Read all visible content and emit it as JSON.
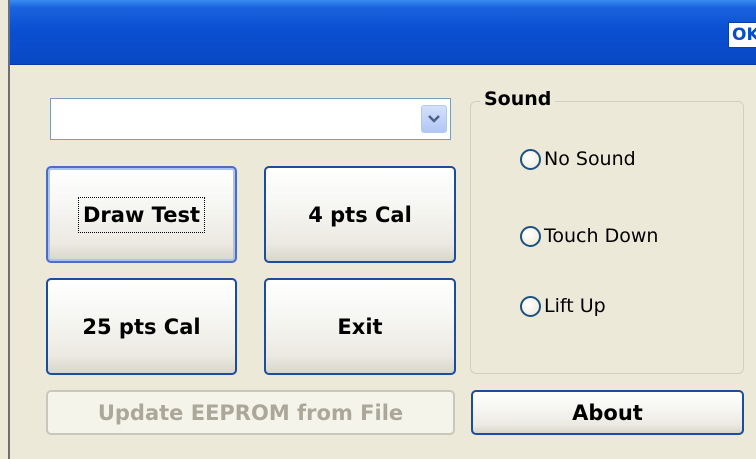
{
  "titlebar": {
    "ok_label": "OK"
  },
  "combo": {
    "value": ""
  },
  "buttons": {
    "draw_test": "Draw Test",
    "cal_4pts": "4 pts Cal",
    "cal_25pts": "25 pts Cal",
    "exit": "Exit",
    "update_eeprom": "Update EEPROM from File",
    "about": "About"
  },
  "sound_group": {
    "title": "Sound",
    "options": [
      {
        "label": "No Sound",
        "selected": false
      },
      {
        "label": "Touch Down",
        "selected": false
      },
      {
        "label": "Lift Up",
        "selected": false
      }
    ]
  },
  "colors": {
    "titlebar_blue": "#0a4ccc",
    "window_bg": "#ece9d8",
    "button_border": "#1c4c9c",
    "disabled_text": "#aca899"
  }
}
